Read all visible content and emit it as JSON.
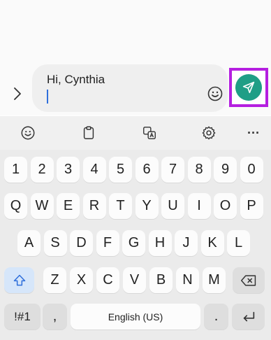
{
  "compose": {
    "message_text": "Hi, Cynthia"
  },
  "icons": {
    "expand": "chevron-right-icon",
    "emoji": "smiley-icon",
    "send": "paper-plane-icon",
    "clipboard": "clipboard-icon",
    "translate": "translate-icon",
    "settings": "gear-icon",
    "more": "more-horizontal-icon",
    "shift": "shift-arrow-icon",
    "backspace": "backspace-icon",
    "enter": "enter-return-icon"
  },
  "colors": {
    "send_button": "#1f9e86",
    "highlight_border": "#b51fe0",
    "cursor": "#2f6fdb",
    "shift_key": "#d6e6fa"
  },
  "toolbar": {
    "more_label": "···"
  },
  "keyboard": {
    "row_numbers": [
      "1",
      "2",
      "3",
      "4",
      "5",
      "6",
      "7",
      "8",
      "9",
      "0"
    ],
    "row_top": [
      "Q",
      "W",
      "E",
      "R",
      "T",
      "Y",
      "U",
      "I",
      "O",
      "P"
    ],
    "row_home": [
      "A",
      "S",
      "D",
      "F",
      "G",
      "H",
      "J",
      "K",
      "L"
    ],
    "row_bottom": [
      "Z",
      "X",
      "C",
      "V",
      "B",
      "N",
      "M"
    ],
    "symbols_label": "!#1",
    "comma_label": ",",
    "space_label": "English (US)",
    "period_label": "."
  }
}
